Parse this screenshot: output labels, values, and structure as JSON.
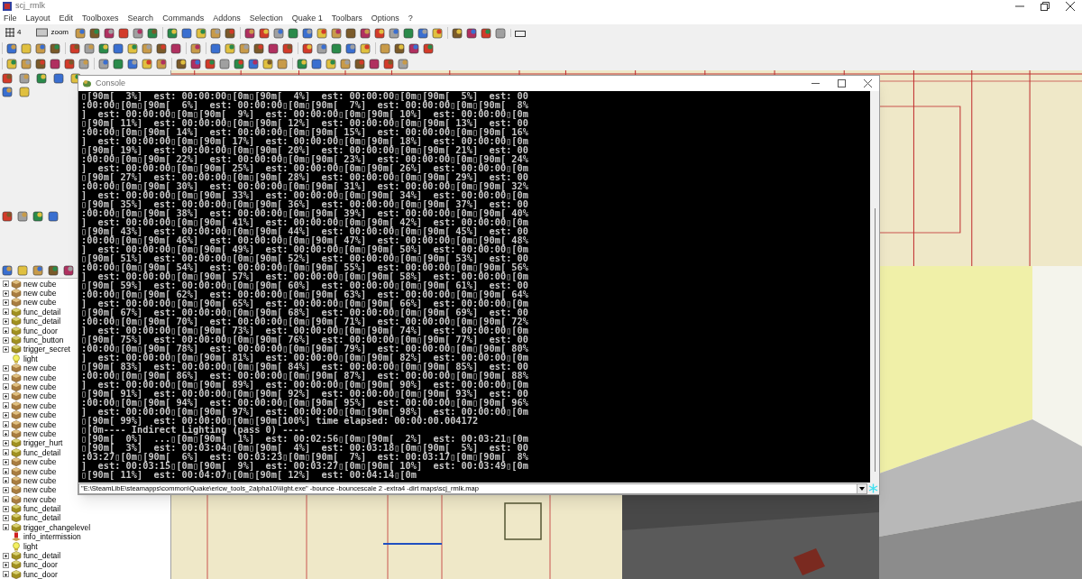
{
  "app": {
    "title": "scj_rmlk"
  },
  "menu": [
    "File",
    "Layout",
    "Edit",
    "Toolboxes",
    "Search",
    "Commands",
    "Addons",
    "Selection",
    "Quake 1",
    "Toolbars",
    "Options",
    "?"
  ],
  "toolbar": {
    "grid_size": "4",
    "zoom_label": "zoom"
  },
  "tree": {
    "items": [
      {
        "label": "new cube",
        "kind": "brush"
      },
      {
        "label": "new cube",
        "kind": "brush"
      },
      {
        "label": "new cube",
        "kind": "brush"
      },
      {
        "label": "func_detail",
        "kind": "entity"
      },
      {
        "label": "func_detail",
        "kind": "entity"
      },
      {
        "label": "func_door",
        "kind": "entity"
      },
      {
        "label": "func_button",
        "kind": "entity"
      },
      {
        "label": "trigger_secret",
        "kind": "entity"
      },
      {
        "label": "light",
        "kind": "light"
      },
      {
        "label": "new cube",
        "kind": "brush"
      },
      {
        "label": "new cube",
        "kind": "brush"
      },
      {
        "label": "new cube",
        "kind": "brush"
      },
      {
        "label": "new cube",
        "kind": "brush"
      },
      {
        "label": "new cube",
        "kind": "brush"
      },
      {
        "label": "new cube",
        "kind": "brush"
      },
      {
        "label": "new cube",
        "kind": "brush"
      },
      {
        "label": "new cube",
        "kind": "brush"
      },
      {
        "label": "trigger_hurt",
        "kind": "entity"
      },
      {
        "label": "func_detail",
        "kind": "entity"
      },
      {
        "label": "new cube",
        "kind": "brush"
      },
      {
        "label": "new cube",
        "kind": "brush"
      },
      {
        "label": "new cube",
        "kind": "brush"
      },
      {
        "label": "new cube",
        "kind": "brush"
      },
      {
        "label": "new cube",
        "kind": "brush"
      },
      {
        "label": "func_detail",
        "kind": "entity"
      },
      {
        "label": "func_detail",
        "kind": "entity"
      },
      {
        "label": "trigger_changelevel",
        "kind": "entity"
      },
      {
        "label": "info_intermission",
        "kind": "point"
      },
      {
        "label": "light",
        "kind": "light"
      },
      {
        "label": "func_detail",
        "kind": "entity"
      },
      {
        "label": "func_door",
        "kind": "entity"
      },
      {
        "label": "func_door",
        "kind": "entity"
      }
    ]
  },
  "console": {
    "title": "Console",
    "lines": [
      "▯[90m[  3%]  est: 00:00:00▯[0m▯[90m[  4%]  est: 00:00:00▯[0m▯[90m[  5%]  est: 00",
      ":00:00▯[0m▯[90m[  6%]  est: 00:00:00▯[0m▯[90m[  7%]  est: 00:00:00▯[0m▯[90m[  8%",
      "]  est: 00:00:00▯[0m▯[90m[  9%]  est: 00:00:00▯[0m▯[90m[ 10%]  est: 00:00:00▯[0m",
      "▯[90m[ 11%]  est: 00:00:00▯[0m▯[90m[ 12%]  est: 00:00:00▯[0m▯[90m[ 13%]  est: 00",
      ":00:00▯[0m▯[90m[ 14%]  est: 00:00:00▯[0m▯[90m[ 15%]  est: 00:00:00▯[0m▯[90m[ 16%",
      "]  est: 00:00:00▯[0m▯[90m[ 17%]  est: 00:00:00▯[0m▯[90m[ 18%]  est: 00:00:00▯[0m",
      "▯[90m[ 19%]  est: 00:00:00▯[0m▯[90m[ 20%]  est: 00:00:00▯[0m▯[90m[ 21%]  est: 00",
      ":00:00▯[0m▯[90m[ 22%]  est: 00:00:00▯[0m▯[90m[ 23%]  est: 00:00:00▯[0m▯[90m[ 24%",
      "]  est: 00:00:00▯[0m▯[90m[ 25%]  est: 00:00:00▯[0m▯[90m[ 26%]  est: 00:00:00▯[0m",
      "▯[90m[ 27%]  est: 00:00:00▯[0m▯[90m[ 28%]  est: 00:00:00▯[0m▯[90m[ 29%]  est: 00",
      ":00:00▯[0m▯[90m[ 30%]  est: 00:00:00▯[0m▯[90m[ 31%]  est: 00:00:00▯[0m▯[90m[ 32%",
      "]  est: 00:00:00▯[0m▯[90m[ 33%]  est: 00:00:00▯[0m▯[90m[ 34%]  est: 00:00:00▯[0m",
      "▯[90m[ 35%]  est: 00:00:00▯[0m▯[90m[ 36%]  est: 00:00:00▯[0m▯[90m[ 37%]  est: 00",
      ":00:00▯[0m▯[90m[ 38%]  est: 00:00:00▯[0m▯[90m[ 39%]  est: 00:00:00▯[0m▯[90m[ 40%",
      "]  est: 00:00:00▯[0m▯[90m[ 41%]  est: 00:00:00▯[0m▯[90m[ 42%]  est: 00:00:00▯[0m",
      "▯[90m[ 43%]  est: 00:00:00▯[0m▯[90m[ 44%]  est: 00:00:00▯[0m▯[90m[ 45%]  est: 00",
      ":00:00▯[0m▯[90m[ 46%]  est: 00:00:00▯[0m▯[90m[ 47%]  est: 00:00:00▯[0m▯[90m[ 48%",
      "]  est: 00:00:00▯[0m▯[90m[ 49%]  est: 00:00:00▯[0m▯[90m[ 50%]  est: 00:00:00▯[0m",
      "▯[90m[ 51%]  est: 00:00:00▯[0m▯[90m[ 52%]  est: 00:00:00▯[0m▯[90m[ 53%]  est: 00",
      ":00:00▯[0m▯[90m[ 54%]  est: 00:00:00▯[0m▯[90m[ 55%]  est: 00:00:00▯[0m▯[90m[ 56%",
      "]  est: 00:00:00▯[0m▯[90m[ 57%]  est: 00:00:00▯[0m▯[90m[ 58%]  est: 00:00:00▯[0m",
      "▯[90m[ 59%]  est: 00:00:00▯[0m▯[90m[ 60%]  est: 00:00:00▯[0m▯[90m[ 61%]  est: 00",
      ":00:00▯[0m▯[90m[ 62%]  est: 00:00:00▯[0m▯[90m[ 63%]  est: 00:00:00▯[0m▯[90m[ 64%",
      "]  est: 00:00:00▯[0m▯[90m[ 65%]  est: 00:00:00▯[0m▯[90m[ 66%]  est: 00:00:00▯[0m",
      "▯[90m[ 67%]  est: 00:00:00▯[0m▯[90m[ 68%]  est: 00:00:00▯[0m▯[90m[ 69%]  est: 00",
      ":00:00▯[0m▯[90m[ 70%]  est: 00:00:00▯[0m▯[90m[ 71%]  est: 00:00:00▯[0m▯[90m[ 72%",
      "]  est: 00:00:00▯[0m▯[90m[ 73%]  est: 00:00:00▯[0m▯[90m[ 74%]  est: 00:00:00▯[0m",
      "▯[90m[ 75%]  est: 00:00:00▯[0m▯[90m[ 76%]  est: 00:00:00▯[0m▯[90m[ 77%]  est: 00",
      ":00:00▯[0m▯[90m[ 78%]  est: 00:00:00▯[0m▯[90m[ 79%]  est: 00:00:00▯[0m▯[90m[ 80%",
      "]  est: 00:00:00▯[0m▯[90m[ 81%]  est: 00:00:00▯[0m▯[90m[ 82%]  est: 00:00:00▯[0m",
      "▯[90m[ 83%]  est: 00:00:00▯[0m▯[90m[ 84%]  est: 00:00:00▯[0m▯[90m[ 85%]  est: 00",
      ":00:00▯[0m▯[90m[ 86%]  est: 00:00:00▯[0m▯[90m[ 87%]  est: 00:00:00▯[0m▯[90m[ 88%",
      "]  est: 00:00:00▯[0m▯[90m[ 89%]  est: 00:00:00▯[0m▯[90m[ 90%]  est: 00:00:00▯[0m",
      "▯[90m[ 91%]  est: 00:00:00▯[0m▯[90m[ 92%]  est: 00:00:00▯[0m▯[90m[ 93%]  est: 00",
      ":00:00▯[0m▯[90m[ 94%]  est: 00:00:00▯[0m▯[90m[ 95%]  est: 00:00:00▯[0m▯[90m[ 96%",
      "]  est: 00:00:00▯[0m▯[90m[ 97%]  est: 00:00:00▯[0m▯[90m[ 98%]  est: 00:00:00▯[0m",
      "▯[90m[ 99%]  est: 00:00:00▯[0m▯[90m[100%] time elapsed: 00:00:00.004172",
      "▯[0m---- Indirect Lighting (pass 0) ----",
      "▯[90m[  0%]  ...▯[0m▯[90m[  1%]  est: 00:02:56▯[0m▯[90m[  2%]  est: 00:03:21▯[0m",
      "▯[90m[  3%]  est: 00:03:04▯[0m▯[90m[  4%]  est: 00:03:18▯[0m▯[90m[  5%]  est: 00",
      ":03:27▯[0m▯[90m[  6%]  est: 00:03:23▯[0m▯[90m[  7%]  est: 00:03:17▯[0m▯[90m[  8%",
      "]  est: 00:03:15▯[0m▯[90m[  9%]  est: 00:03:27▯[0m▯[90m[ 10%]  est: 00:03:49▯[0m",
      "▯[90m[ 11%]  est: 00:04:07▯[0m▯[90m[ 12%]  est: 00:04:14▯[0m"
    ],
    "command": "\"E:\\SteamLibE\\steamapps\\common\\Quake\\ericw_tools_2alpha10\\\\light.exe\" -bounce -bouncescale 2 -extra4 -dirt maps\\scj_rmlk.map"
  }
}
